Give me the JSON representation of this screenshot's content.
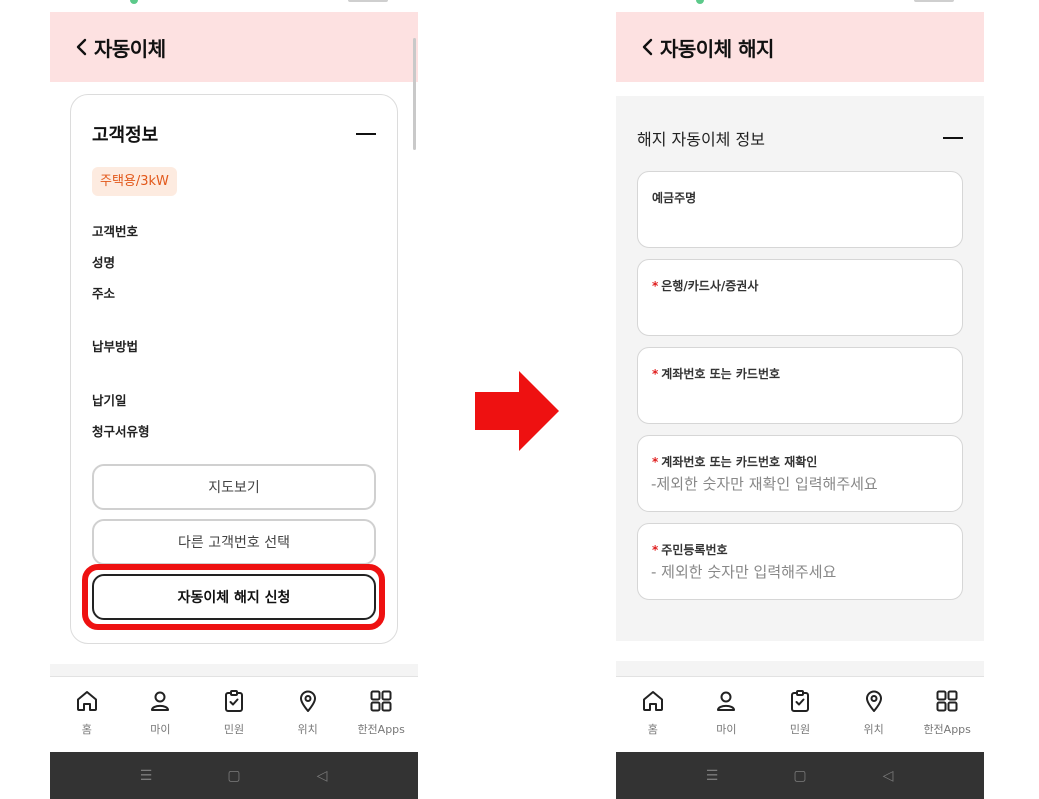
{
  "colors": {
    "header_bg": "#fde1e1",
    "accent_red": "#ee1111",
    "tag_bg": "#fdebe0",
    "tag_text": "#e2581a",
    "arrow": "#ee1111"
  },
  "left": {
    "header": {
      "title": "자동이체"
    },
    "card": {
      "title": "고객정보",
      "tag": "주택용/3kW",
      "labels": [
        "고객번호",
        "성명",
        "주소",
        "납부방법",
        "납기일",
        "청구서유형"
      ],
      "buttons": {
        "map": "지도보기",
        "other_customer": "다른 고객번호 선택",
        "cancel_request": "자동이체 해지 신청"
      }
    }
  },
  "right": {
    "header": {
      "title": "자동이체 해지"
    },
    "section_title": "해지 자동이체 정보",
    "fields": [
      {
        "label": "예금주명",
        "required": false,
        "placeholder": ""
      },
      {
        "label": "은행/카드사/증권사",
        "required": true,
        "placeholder": ""
      },
      {
        "label": "계좌번호 또는 카드번호",
        "required": true,
        "placeholder": ""
      },
      {
        "label": "계좌번호 또는 카드번호 재확인",
        "required": true,
        "placeholder": "-제외한 숫자만 재확인 입력해주세요"
      },
      {
        "label": "주민등록번호",
        "required": true,
        "placeholder": "- 제외한 숫자만 입력해주세요"
      }
    ]
  },
  "nav": {
    "items": [
      {
        "label": "홈",
        "icon": "home-icon"
      },
      {
        "label": "마이",
        "icon": "person-icon"
      },
      {
        "label": "민원",
        "icon": "clipboard-check-icon"
      },
      {
        "label": "위치",
        "icon": "location-pin-icon"
      },
      {
        "label": "한전Apps",
        "icon": "grid-apps-icon"
      }
    ]
  },
  "android": {
    "recent": "☰",
    "home": "▢",
    "back": "◁"
  }
}
